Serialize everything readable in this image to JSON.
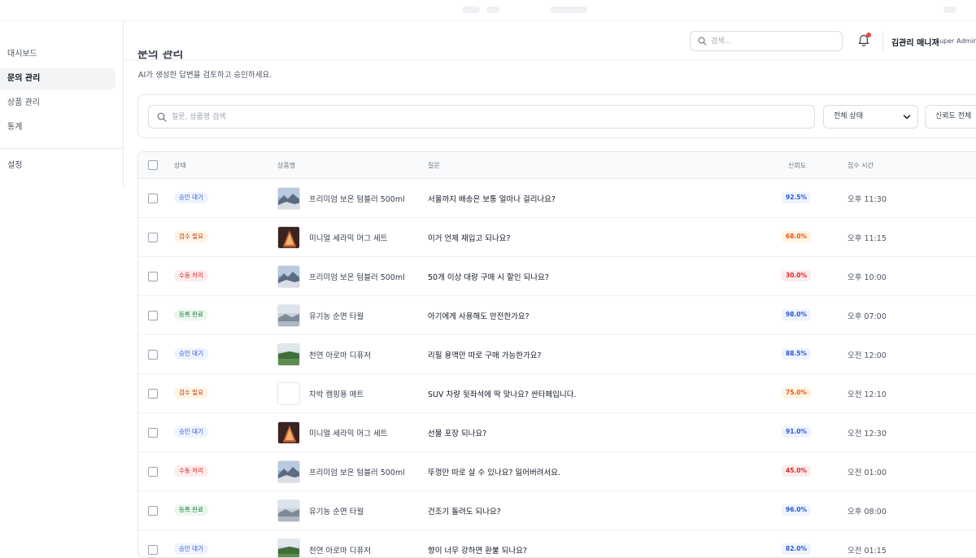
{
  "sidebar": {
    "items": [
      {
        "label": "대시보드",
        "active": false
      },
      {
        "label": "문의 관리",
        "active": true
      },
      {
        "label": "상품 관리",
        "active": false
      },
      {
        "label": "통계",
        "active": false
      }
    ],
    "settings_label": "설정"
  },
  "header": {
    "search_placeholder": "검색...",
    "user_name": "김관리 매니저",
    "user_role": "Super Admin",
    "notification_dot_color": "#ef4444"
  },
  "page": {
    "title": "문의 관리",
    "subtitle": "AI가 생성한 답변을 검토하고 승인하세요."
  },
  "filters": {
    "search_placeholder": "질문, 상품명 검색",
    "status_select": "전체 상태",
    "confidence_select": "신뢰도 전체"
  },
  "table": {
    "columns": {
      "status": "상태",
      "product": "상품명",
      "question": "질문",
      "confidence": "신뢰도",
      "time": "접수 시간"
    },
    "rows": [
      {
        "status": "승인 대기",
        "status_kind": "blue",
        "product": "프리미엄 보온 텀블러 500ml",
        "thumb": "mountain",
        "question": "서울까지 배송은 보통 얼마나 걸리나요?",
        "confidence": "92.5%",
        "conf_kind": "blue",
        "time": "오후 11:30"
      },
      {
        "status": "검수 필요",
        "status_kind": "orange",
        "product": "미니멀 세라믹 머그 세트",
        "thumb": "lamp",
        "question": "이거 언제 재입고 되나요?",
        "confidence": "68.0%",
        "conf_kind": "orange",
        "time": "오후 11:15"
      },
      {
        "status": "수동 처리",
        "status_kind": "red",
        "product": "프리미엄 보온 텀블러 500ml",
        "thumb": "mountain",
        "question": "50개 이상 대량 구매 시 할인 되나요?",
        "confidence": "30.0%",
        "conf_kind": "red",
        "time": "오후 10:00"
      },
      {
        "status": "등록 완료",
        "status_kind": "green",
        "product": "유기농 순면 타월",
        "thumb": "mist",
        "question": "아기에게 사용해도 안전한가요?",
        "confidence": "98.0%",
        "conf_kind": "blue",
        "time": "오후 07:00"
      },
      {
        "status": "승인 대기",
        "status_kind": "blue",
        "product": "천연 아로마 디퓨저",
        "thumb": "field",
        "question": "리필 용액만 따로 구매 가능한가요?",
        "confidence": "88.5%",
        "conf_kind": "blue",
        "time": "오전 12:00"
      },
      {
        "status": "검수 필요",
        "status_kind": "orange",
        "product": "차박 캠핑용 매트",
        "thumb": "blank",
        "question": "SUV 차량 뒷좌석에 딱 맞나요? 싼타페입니다.",
        "confidence": "75.0%",
        "conf_kind": "orange",
        "time": "오전 12:10"
      },
      {
        "status": "승인 대기",
        "status_kind": "blue",
        "product": "미니멀 세라믹 머그 세트",
        "thumb": "lamp",
        "question": "선물 포장 되나요?",
        "confidence": "91.0%",
        "conf_kind": "blue",
        "time": "오전 12:30"
      },
      {
        "status": "수동 처리",
        "status_kind": "red",
        "product": "프리미엄 보온 텀블러 500ml",
        "thumb": "mountain",
        "question": "뚜껑만 따로 살 수 있나요? 잃어버려서요.",
        "confidence": "45.0%",
        "conf_kind": "red",
        "time": "오전 01:00"
      },
      {
        "status": "등록 완료",
        "status_kind": "green",
        "product": "유기농 순면 타월",
        "thumb": "mist",
        "question": "건조기 돌려도 되나요?",
        "confidence": "96.0%",
        "conf_kind": "blue",
        "time": "오후 08:00"
      },
      {
        "status": "승인 대기",
        "status_kind": "blue",
        "product": "천연 아로마 디퓨저",
        "thumb": "field",
        "question": "향이 너무 강하면 환불 되나요?",
        "confidence": "82.0%",
        "conf_kind": "blue",
        "time": "오전 01:15"
      }
    ]
  }
}
